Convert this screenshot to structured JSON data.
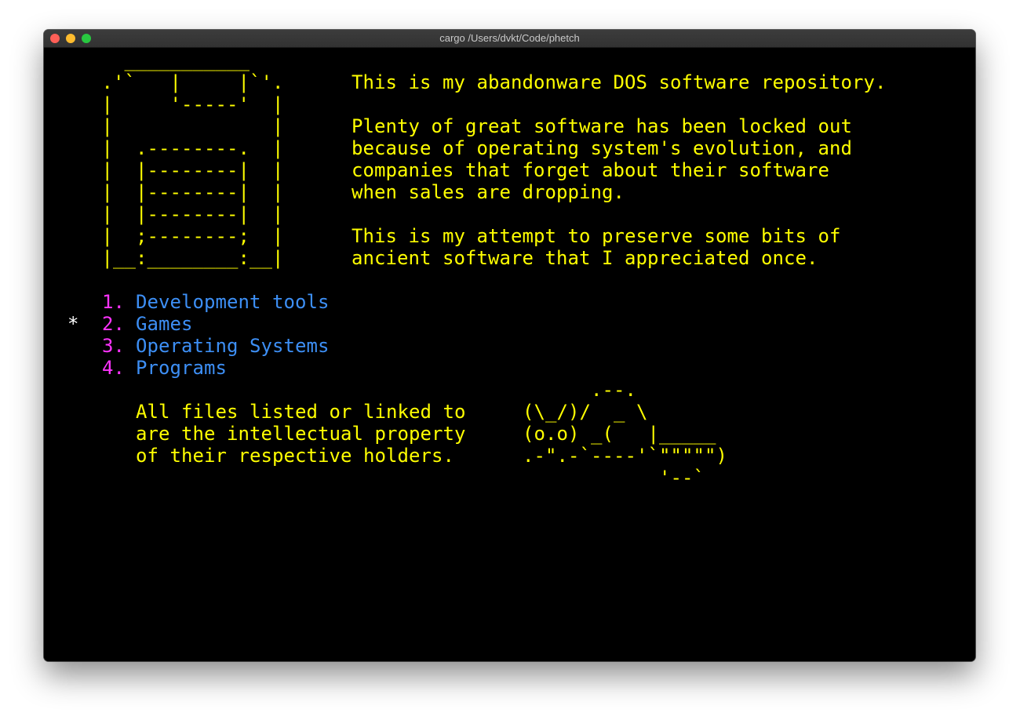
{
  "window": {
    "title": "cargo /Users/dvkt/Code/phetch",
    "traffic_lights": [
      {
        "name": "close",
        "color": "#ff5f57"
      },
      {
        "name": "minimize",
        "color": "#febc2e"
      },
      {
        "name": "zoom",
        "color": "#28c840"
      }
    ]
  },
  "colors": {
    "background": "#000000",
    "text_yellow": "#ffff00",
    "menu_number": "#ff33ff",
    "menu_link": "#3d8ff5",
    "cursor": "#ffffff"
  },
  "floppy_art": [
    "     ___________",
    "   .'`   |     |`'.",
    "   |     '-----'  |",
    "   |              |",
    "   |  .--------.  |",
    "   |  |--------|  |",
    "   |  |--------|  |",
    "   |  |--------|  |",
    "   |  ;--------;  |",
    "   |__:________:__|"
  ],
  "intro": {
    "line1": "This is my abandonware DOS software repository.",
    "para2": [
      "Plenty of great software has been locked out",
      "because of operating system's evolution, and",
      "companies that forget about their software",
      "when sales are dropping."
    ],
    "para3": [
      "This is my attempt to preserve some bits of",
      "ancient software that I appreciated once."
    ]
  },
  "menu": {
    "cursor": "*",
    "selected_index": 1,
    "items": [
      {
        "number": "1.",
        "label": "Development tools"
      },
      {
        "number": "2.",
        "label": "Games"
      },
      {
        "number": "3.",
        "label": "Operating Systems"
      },
      {
        "number": "4.",
        "label": "Programs"
      }
    ]
  },
  "disclaimer": [
    "All files listed or linked to",
    "are the intellectual property",
    "of their respective holders."
  ],
  "turtle_art": [
    "      .--.",
    "(\\_/)/  _ \\",
    "(o.o) _(   |_____",
    ".-\".-`----'`\"\"\"\"\")",
    "            '--`"
  ]
}
